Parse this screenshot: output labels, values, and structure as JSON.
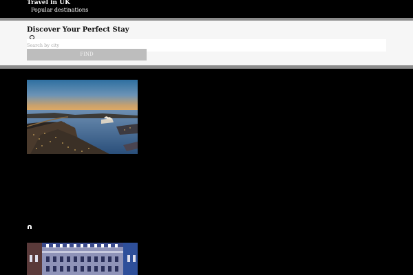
{
  "header": {
    "brand": "Travel in UK",
    "nav_item": "Popular destinations"
  },
  "search": {
    "title": "Discover Your Perfect Stay",
    "placeholder": "Search by city",
    "button_label": "FIND"
  },
  "icons": {
    "radio": "radio-circle-icon",
    "marker": "location-pin-icon"
  },
  "colors": {
    "page_background": "#000000",
    "panel_background": "#f6f6f6",
    "panel_border": "#8c8c8c",
    "button_background": "#bdbdbd"
  }
}
